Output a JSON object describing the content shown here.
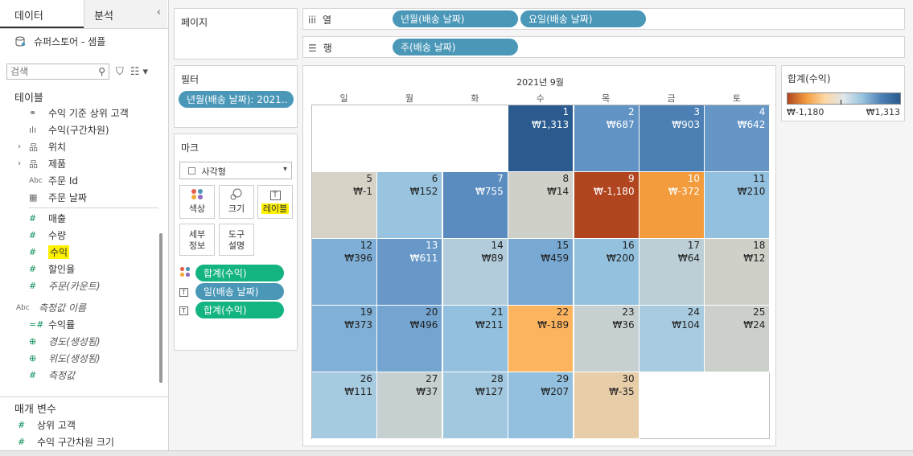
{
  "panel_tabs": {
    "data": "데이터",
    "analysis": "분석"
  },
  "datasource": "슈퍼스토어 - 샘플",
  "search": {
    "placeholder": "검색"
  },
  "tables_title": "테이블",
  "fields": [
    {
      "label": "수익 기준 상위 고객",
      "icon": "set-icon",
      "italic": false
    },
    {
      "label": "수익(구간차원)",
      "icon": "bin-icon",
      "italic": false
    },
    {
      "label": "위치",
      "icon": "hierarchy-icon",
      "italic": false,
      "arrow": true
    },
    {
      "label": "제품",
      "icon": "hierarchy-icon",
      "italic": false,
      "arrow": true
    },
    {
      "label": "주문 Id",
      "icon": "abc-icon",
      "italic": false
    },
    {
      "label": "주문 날짜",
      "icon": "date-icon",
      "italic": false
    }
  ],
  "measures": [
    {
      "label": "매출",
      "italic": false,
      "highlight": false
    },
    {
      "label": "수량",
      "italic": false,
      "highlight": false
    },
    {
      "label": "수익",
      "italic": false,
      "highlight": true
    },
    {
      "label": "할인율",
      "italic": false,
      "highlight": false
    },
    {
      "label": "주문(카운트)",
      "italic": true,
      "highlight": false
    }
  ],
  "extra_fields": [
    {
      "label": "측정값 이름",
      "icon": "Abc",
      "italic": true
    },
    {
      "label": "수익률",
      "icon": "=#",
      "italic": false
    },
    {
      "label": "경도(생성됨)",
      "icon": "globe",
      "italic": true
    },
    {
      "label": "위도(생성됨)",
      "icon": "globe",
      "italic": true
    },
    {
      "label": "측정값",
      "icon": "#",
      "italic": true
    }
  ],
  "params_title": "매개 변수",
  "params": [
    {
      "label": "상위 고객"
    },
    {
      "label": "수익 구간차원 크기"
    }
  ],
  "pages_title": "페이지",
  "filters_title": "필터",
  "filter_pill": "년월(배송 날짜): 2021..",
  "marks": {
    "title": "마크",
    "type": "사각형",
    "buttons": {
      "color": "색상",
      "size": "크기",
      "label": "레이블",
      "detail": "세부\n정보",
      "tooltip": "도구\n설명"
    },
    "pills": [
      {
        "label": "합계(수익)",
        "icon": "color-dots",
        "color": "green"
      },
      {
        "label": "일(배송 날짜)",
        "icon": "T",
        "color": "blue"
      },
      {
        "label": "합계(수익)",
        "icon": "T",
        "color": "green"
      }
    ]
  },
  "columns": {
    "label": "열",
    "pills": [
      "년월(배송 날짜)",
      "요일(배송 날짜)"
    ]
  },
  "rows": {
    "label": "행",
    "pills": [
      "주(배송 날짜)"
    ]
  },
  "calendar": {
    "title": "2021년 9월",
    "weekdays": [
      "일",
      "월",
      "화",
      "수",
      "목",
      "금",
      "토"
    ],
    "first_weekday_index": 3,
    "days": [
      {
        "d": "1",
        "v": "₩1,313",
        "c": "#2b5b8e"
      },
      {
        "d": "2",
        "v": "₩687",
        "c": "#6193c4"
      },
      {
        "d": "3",
        "v": "₩903",
        "c": "#4c7fb4"
      },
      {
        "d": "4",
        "v": "₩642",
        "c": "#6596c6"
      },
      {
        "d": "5",
        "v": "₩-1",
        "c": "#d6d2c6"
      },
      {
        "d": "6",
        "v": "₩152",
        "c": "#98c4df"
      },
      {
        "d": "7",
        "v": "₩755",
        "c": "#5a8cc0"
      },
      {
        "d": "8",
        "v": "₩14",
        "c": "#cfd0c8"
      },
      {
        "d": "9",
        "v": "₩-1,180",
        "c": "#b0451f"
      },
      {
        "d": "10",
        "v": "₩-372",
        "c": "#f39c3e"
      },
      {
        "d": "11",
        "v": "₩210",
        "c": "#92c0de"
      },
      {
        "d": "12",
        "v": "₩396",
        "c": "#7fafd6"
      },
      {
        "d": "13",
        "v": "₩611",
        "c": "#6898c8"
      },
      {
        "d": "14",
        "v": "₩89",
        "c": "#b2ccdb"
      },
      {
        "d": "15",
        "v": "₩459",
        "c": "#78a9d3"
      },
      {
        "d": "16",
        "v": "₩200",
        "c": "#93c1de"
      },
      {
        "d": "17",
        "v": "₩64",
        "c": "#bccfd6"
      },
      {
        "d": "18",
        "v": "₩12",
        "c": "#cfd0c8"
      },
      {
        "d": "19",
        "v": "₩373",
        "c": "#80b0d6"
      },
      {
        "d": "20",
        "v": "₩496",
        "c": "#74a5d0"
      },
      {
        "d": "21",
        "v": "₩211",
        "c": "#92c0de"
      },
      {
        "d": "22",
        "v": "₩-189",
        "c": "#fdb45f"
      },
      {
        "d": "23",
        "v": "₩36",
        "c": "#c7d0d0"
      },
      {
        "d": "24",
        "v": "₩104",
        "c": "#a9cbe0"
      },
      {
        "d": "25",
        "v": "₩24",
        "c": "#cbd0cb"
      },
      {
        "d": "26",
        "v": "₩111",
        "c": "#a6cae0"
      },
      {
        "d": "27",
        "v": "₩37",
        "c": "#c6d0d0"
      },
      {
        "d": "28",
        "v": "₩127",
        "c": "#a2c8df"
      },
      {
        "d": "29",
        "v": "₩207",
        "c": "#92c0de"
      },
      {
        "d": "30",
        "v": "₩-35",
        "c": "#e7cda8"
      }
    ]
  },
  "legend": {
    "title": "합계(수익)",
    "min": "₩-1,180",
    "max": "₩1,313",
    "colors": [
      "#b0451f",
      "#f39c3e",
      "#fdd9a8",
      "#dfe6ea",
      "#98c4df",
      "#4c7fb4",
      "#2b5b8e"
    ]
  }
}
